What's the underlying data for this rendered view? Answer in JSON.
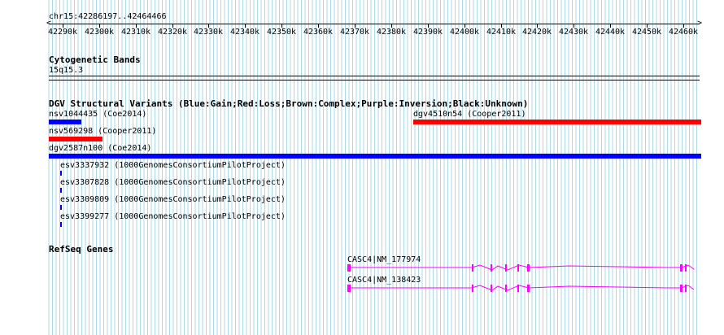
{
  "position": {
    "text": "chr15:42286197..42464466"
  },
  "ruler": {
    "ticks": [
      "42290k",
      "42300k",
      "42310k",
      "42320k",
      "42330k",
      "42340k",
      "42350k",
      "42360k",
      "42370k",
      "42380k",
      "42390k",
      "42400k",
      "42410k",
      "42420k",
      "42430k",
      "42440k",
      "42450k",
      "42460k"
    ]
  },
  "tracks": {
    "cytoband": {
      "title": "Cytogenetic Bands",
      "band": "15q15.3"
    },
    "dgv": {
      "title": "DGV Structural Variants (Blue:Gain;Red:Loss;Brown:Complex;Purple:Inversion;Black:Unknown)",
      "features": [
        {
          "label": "nsv1044435 (Coe2014)",
          "color": "#0000ff"
        },
        {
          "label": "dgv4510n54 (Cooper2011)",
          "color": "#ff0000"
        },
        {
          "label": "nsv569298 (Cooper2011)",
          "color": "#ff0000"
        },
        {
          "label": "dgv2587n100 (Coe2014)",
          "color": "#0000ff"
        },
        {
          "label": "esv3337932 (1000GenomesConsortiumPilotProject)",
          "color": "#0000ff"
        },
        {
          "label": "esv3307828 (1000GenomesConsortiumPilotProject)",
          "color": "#0000ff"
        },
        {
          "label": "esv3309809 (1000GenomesConsortiumPilotProject)",
          "color": "#0000ff"
        },
        {
          "label": "esv3399277 (1000GenomesConsortiumPilotProject)",
          "color": "#0000ff"
        }
      ]
    },
    "refseq": {
      "title": "RefSeq Genes",
      "color": "#ff00ff",
      "genes": [
        {
          "label": "CASC4|NM_177974"
        },
        {
          "label": "CASC4|NM_138423"
        }
      ]
    }
  },
  "colors": {
    "grid": "#add8e6",
    "gain": "#0000ff",
    "loss": "#ff0000",
    "gene": "#ff00ff"
  }
}
